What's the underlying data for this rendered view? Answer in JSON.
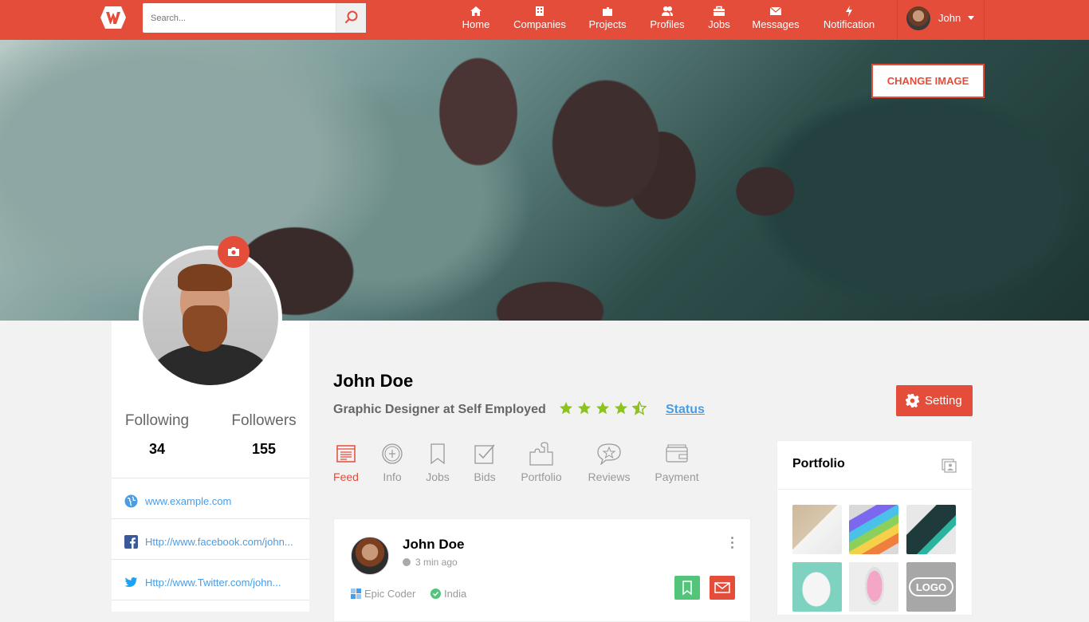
{
  "search": {
    "placeholder": "Search..."
  },
  "nav": {
    "items": [
      {
        "label": "Home",
        "icon": "home-icon"
      },
      {
        "label": "Companies",
        "icon": "companies-icon"
      },
      {
        "label": "Projects",
        "icon": "projects-icon"
      },
      {
        "label": "Profiles",
        "icon": "profiles-icon"
      },
      {
        "label": "Jobs",
        "icon": "jobs-icon"
      },
      {
        "label": "Messages",
        "icon": "messages-icon"
      },
      {
        "label": "Notification",
        "icon": "notification-icon"
      }
    ],
    "user_name": "John"
  },
  "cover": {
    "change_image_label": "CHANGE IMAGE"
  },
  "stats": {
    "following_label": "Following",
    "following_value": "34",
    "followers_label": "Followers",
    "followers_value": "155"
  },
  "links": [
    {
      "text": "www.example.com",
      "icon": "globe-icon"
    },
    {
      "text": "Http://www.facebook.com/john...",
      "icon": "facebook-icon"
    },
    {
      "text": "Http://www.Twitter.com/john...",
      "icon": "twitter-icon"
    }
  ],
  "profile": {
    "name": "John Doe",
    "title": "Graphic Designer at Self Employed",
    "rating": 4.5,
    "status_label": "Status",
    "setting_label": "Setting"
  },
  "tabs": [
    {
      "label": "Feed",
      "icon": "feed-icon",
      "active": true
    },
    {
      "label": "Info",
      "icon": "info-icon",
      "active": false
    },
    {
      "label": "Jobs",
      "icon": "bookmark-icon",
      "active": false
    },
    {
      "label": "Bids",
      "icon": "bids-icon",
      "active": false
    },
    {
      "label": "Portfolio",
      "icon": "portfolio-icon",
      "active": false
    },
    {
      "label": "Reviews",
      "icon": "reviews-icon",
      "active": false
    },
    {
      "label": "Payment",
      "icon": "payment-icon",
      "active": false
    }
  ],
  "post": {
    "author": "John Doe",
    "time": "3 min ago",
    "company": "Epic Coder",
    "location": "India"
  },
  "portfolio": {
    "title": "Portfolio",
    "thumbs": [
      "business-cards",
      "color-cards",
      "dark-cards",
      "mug-mockup",
      "phone-mockup",
      "logo-mockup"
    ]
  },
  "colors": {
    "accent": "#e44d3a",
    "link": "#4a9de4",
    "star": "#8dc21f",
    "bookmark": "#53c57a"
  }
}
